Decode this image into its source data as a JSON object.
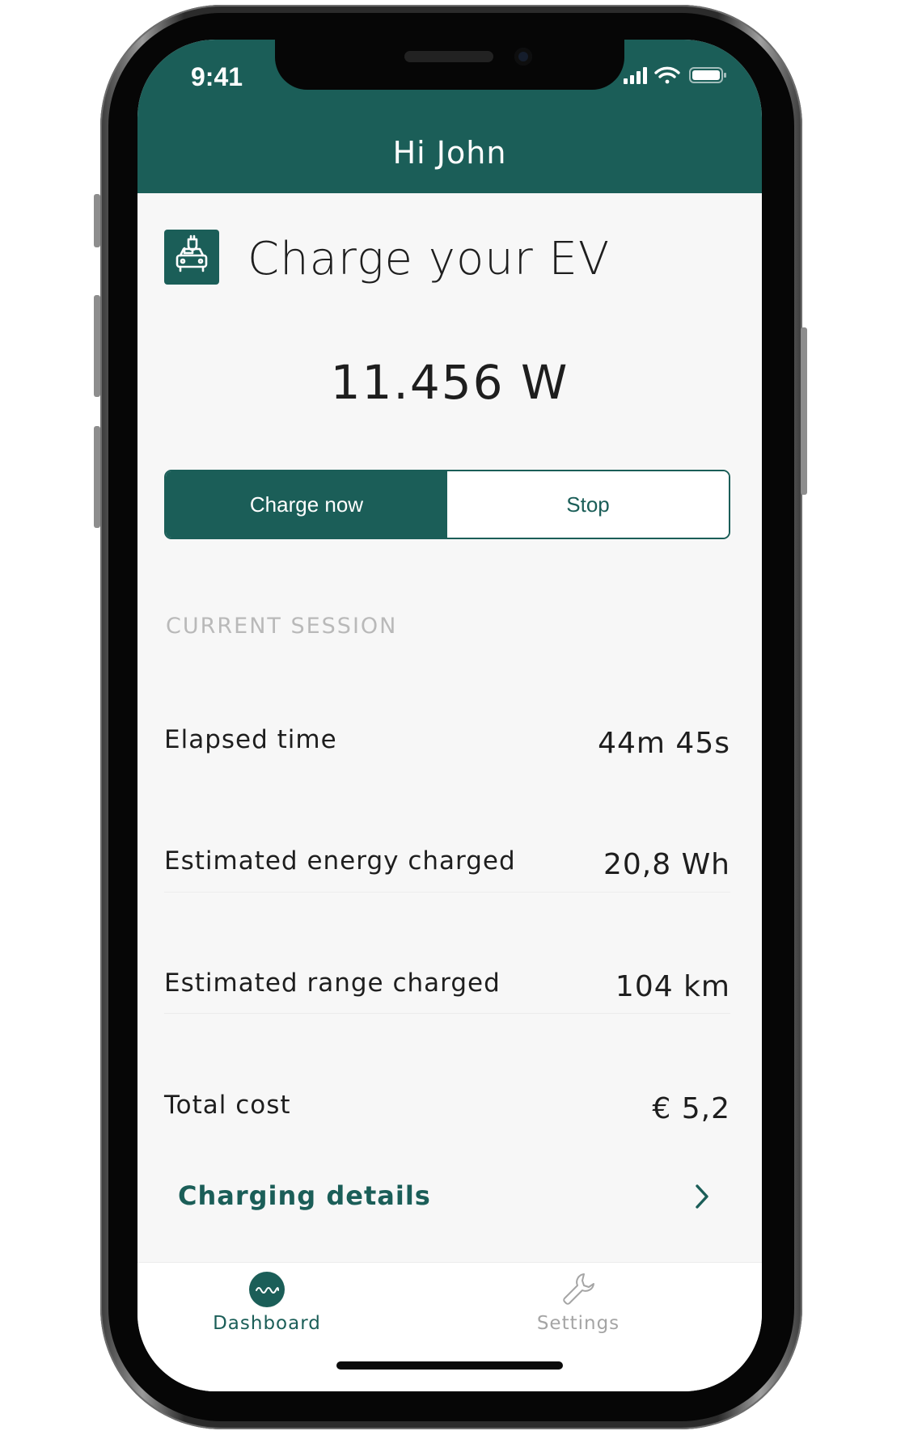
{
  "status_bar": {
    "time": "9:41",
    "icons": [
      "signal-icon",
      "wifi-icon",
      "battery-icon"
    ]
  },
  "header": {
    "greeting": "Hi John",
    "background_color": "#1b5e58"
  },
  "charge": {
    "icon": "ev-charging-icon",
    "title": "Charge your EV",
    "power": "11.456 W",
    "charge_now_label": "Charge now",
    "stop_label": "Stop",
    "active_button": "Charge now"
  },
  "session": {
    "section_label": "CURRENT SESSION",
    "rows": [
      {
        "label": "Elapsed time",
        "value": "44m 45s"
      },
      {
        "label": "Estimated energy charged",
        "value": "20,8 Wh"
      },
      {
        "label": "Estimated range charged",
        "value": "104 km"
      },
      {
        "label": "Total cost",
        "value": "€ 5,2"
      }
    ],
    "details_link": "Charging details",
    "details_icon": "chevron-right-icon"
  },
  "tabbar": {
    "tabs": [
      {
        "label": "Dashboard",
        "icon": "dashboard-wave-icon",
        "active": true
      },
      {
        "label": "Settings",
        "icon": "wrench-icon",
        "active": false
      }
    ]
  },
  "colors": {
    "accent": "#1b5e58",
    "muted": "#b9b9b9",
    "text": "#1e1e1e"
  }
}
